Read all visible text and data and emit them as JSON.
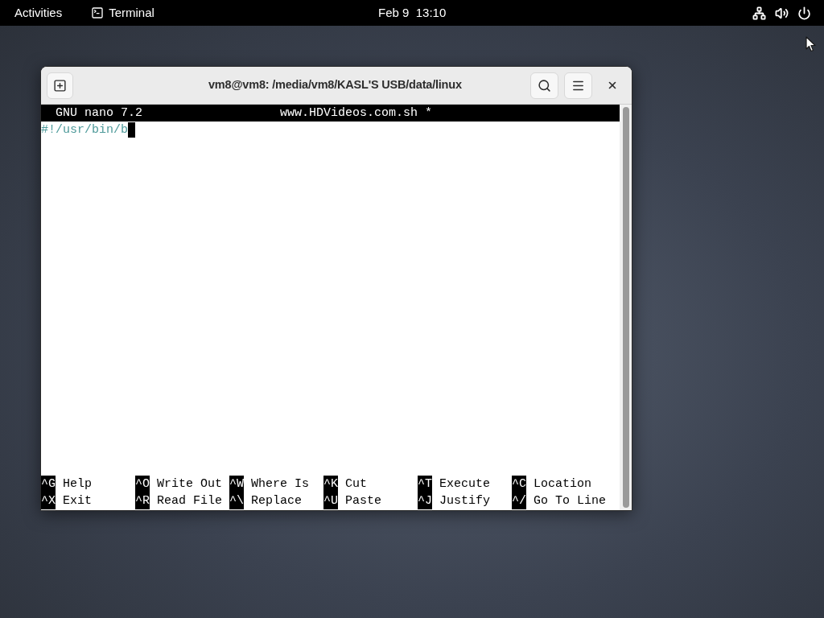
{
  "top_bar": {
    "activities": "Activities",
    "app_menu": "Terminal",
    "clock": "Feb 9  13:10"
  },
  "window": {
    "title": "vm8@vm8: /media/vm8/KASL'S USB/data/linux"
  },
  "nano": {
    "version": "GNU nano 7.2",
    "filename": "www.HDVideos.com.sh *",
    "lines": [
      "#!/usr/bin/b"
    ],
    "shortcuts": [
      {
        "key": "^G",
        "label": "Help"
      },
      {
        "key": "^O",
        "label": "Write Out"
      },
      {
        "key": "^W",
        "label": "Where Is"
      },
      {
        "key": "^K",
        "label": "Cut"
      },
      {
        "key": "^T",
        "label": "Execute"
      },
      {
        "key": "^C",
        "label": "Location"
      },
      {
        "key": "^X",
        "label": "Exit"
      },
      {
        "key": "^R",
        "label": "Read File"
      },
      {
        "key": "^\\",
        "label": "Replace"
      },
      {
        "key": "^U",
        "label": "Paste"
      },
      {
        "key": "^J",
        "label": "Justify"
      },
      {
        "key": "^/",
        "label": "Go To Line"
      }
    ]
  }
}
